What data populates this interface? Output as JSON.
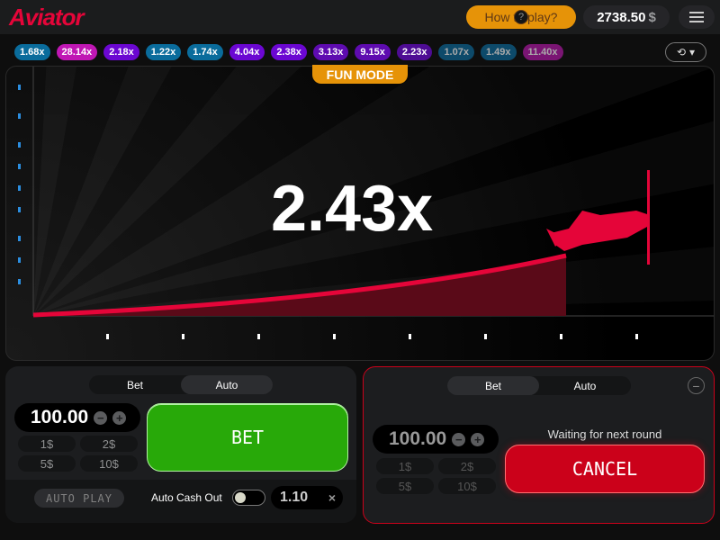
{
  "header": {
    "logo": "Aviator",
    "how_to_play": "How to play?",
    "balance": "2738.50",
    "currency": "$",
    "menu_icon": "hamburger-icon"
  },
  "history": [
    {
      "v": "1.68x",
      "c": "#0a6c9c"
    },
    {
      "v": "28.14x",
      "c": "#c017b4"
    },
    {
      "v": "2.18x",
      "c": "#6b07d2"
    },
    {
      "v": "1.22x",
      "c": "#0a6c9c"
    },
    {
      "v": "1.74x",
      "c": "#0a6c9c"
    },
    {
      "v": "4.04x",
      "c": "#6b07d2"
    },
    {
      "v": "2.38x",
      "c": "#6b07d2"
    },
    {
      "v": "3.13x",
      "c": "#5e0bb0"
    },
    {
      "v": "9.15x",
      "c": "#5e0bb0"
    },
    {
      "v": "2.23x",
      "c": "#4e0c94"
    },
    {
      "v": "1.07x",
      "c": "#0d4a6a"
    },
    {
      "v": "1.49x",
      "c": "#0d4a6a"
    },
    {
      "v": "11.40x",
      "c": "#7a1573"
    }
  ],
  "game": {
    "mode": "FUN MODE",
    "multiplier": "2.43x"
  },
  "panel1": {
    "tab_bet": "Bet",
    "tab_auto": "Auto",
    "amount": "100.00",
    "quick": [
      "1$",
      "2$",
      "5$",
      "10$"
    ],
    "bet_label": "BET",
    "auto_play": "AUTO PLAY",
    "auto_cash_out": "Auto Cash Out",
    "cash_out_value": "1.10",
    "clear": "×"
  },
  "panel2": {
    "tab_bet": "Bet",
    "tab_auto": "Auto",
    "amount": "100.00",
    "quick": [
      "1$",
      "2$",
      "5$",
      "10$"
    ],
    "status": "Waiting for next round",
    "cancel_label": "CANCEL"
  }
}
